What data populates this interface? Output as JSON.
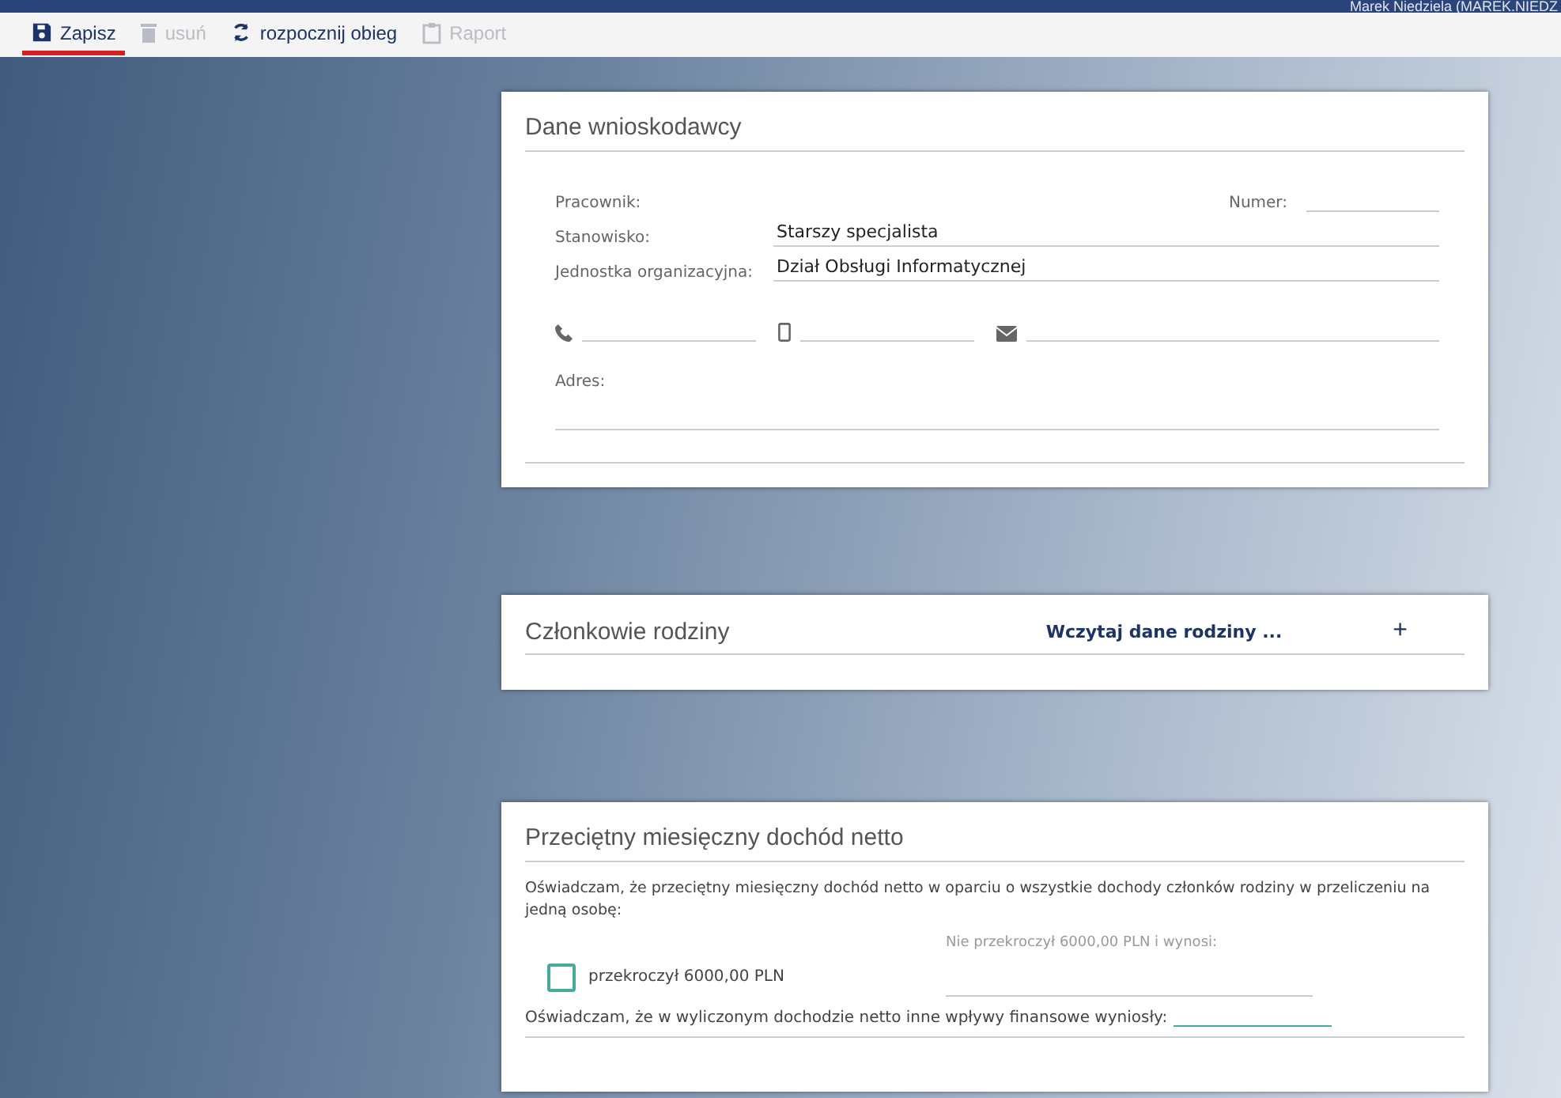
{
  "top_bar": {
    "user": "Marek Niedziela (MAREK.NIEDZ"
  },
  "toolbar": [
    {
      "label": "Zapisz",
      "kind": "save",
      "disabled": false,
      "selected": true
    },
    {
      "label": "usuń",
      "kind": "delete",
      "disabled": true,
      "selected": false
    },
    {
      "label": "rozpocznij obieg",
      "kind": "workflow",
      "disabled": false,
      "selected": false
    },
    {
      "label": "Raport",
      "kind": "report",
      "disabled": true,
      "selected": false
    }
  ],
  "applicant": {
    "title": "Dane wnioskodawcy",
    "employee_label": "Pracownik:",
    "number_label": "Numer:",
    "position_label": "Stanowisko:",
    "position_value": "Starszy specjalista",
    "unit_label": "Jednostka organizacyjna:",
    "unit_value": "Dział Obsługi Informatycznej",
    "address_label": "Adres:"
  },
  "family": {
    "title": "Członkowie rodziny",
    "load_link": "Wczytaj dane rodziny ...",
    "add": "+"
  },
  "income": {
    "title": "Przeciętny miesięczny dochód netto",
    "statement": "Oświadczam, że przeciętny miesięczny dochód netto w oparciu o wszystkie dochody członków rodziny w przeliczeniu na jedną osobę:",
    "exceeded_label": "przekroczył 6000,00 PLN",
    "exceeded_checked": false,
    "not_exceeded_label": "Nie przekroczył 6000,00 PLN i wynosi:",
    "other_statement": "Oświadczam, że w wyliczonym dochodzie netto inne wpływy finansowe wyniosły:"
  }
}
